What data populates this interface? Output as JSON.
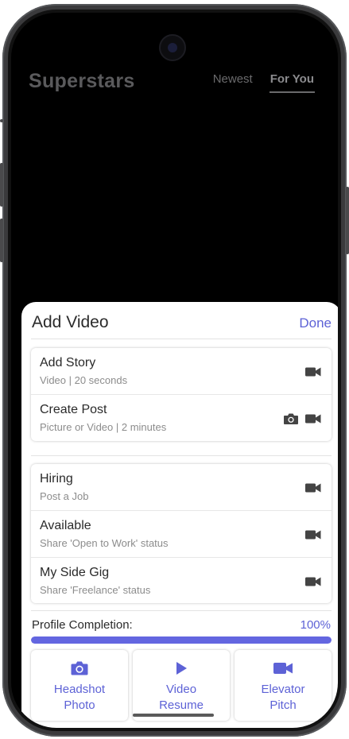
{
  "header": {
    "title": "Superstars",
    "tabs": [
      {
        "label": "Newest",
        "active": false
      },
      {
        "label": "For You",
        "active": true
      }
    ]
  },
  "sheet": {
    "title": "Add Video",
    "done_label": "Done",
    "post_options": [
      {
        "title": "Add Story",
        "subtitle": "Video | 20 seconds",
        "icons": [
          "video-camera-icon"
        ]
      },
      {
        "title": "Create Post",
        "subtitle": "Picture or Video | 2 minutes",
        "icons": [
          "camera-icon",
          "video-camera-icon"
        ]
      }
    ],
    "status_options": [
      {
        "title": "Hiring",
        "subtitle": "Post a Job",
        "icons": [
          "video-camera-icon"
        ]
      },
      {
        "title": "Available",
        "subtitle": "Share 'Open to Work' status",
        "icons": [
          "video-camera-icon"
        ]
      },
      {
        "title": "My Side Gig",
        "subtitle": "Share 'Freelance' status",
        "icons": [
          "video-camera-icon"
        ]
      }
    ],
    "profile_completion": {
      "label": "Profile Completion:",
      "value_text": "100%",
      "value_fraction": 1.0
    },
    "actions": [
      {
        "label": "Headshot\nPhoto",
        "icon": "camera-icon"
      },
      {
        "label": "Video\nResume",
        "icon": "play-icon"
      },
      {
        "label": "Elevator\nPitch",
        "icon": "video-camera-icon"
      }
    ]
  },
  "colors": {
    "accent": "#5d62d6",
    "progress_fill": "#6366e0",
    "screen_background": "#000000",
    "icon_gray": "#444444"
  }
}
